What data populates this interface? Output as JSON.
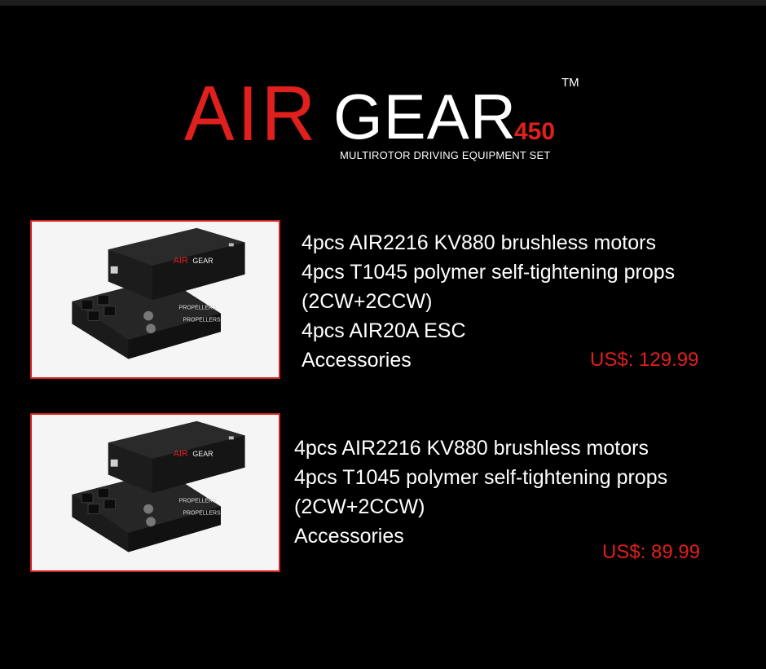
{
  "logo": {
    "air": "AIR",
    "gear": "GEAR",
    "model": "450",
    "tm": "TM",
    "subtitle": "MULTIROTOR DRIVING EQUIPMENT SET"
  },
  "products": [
    {
      "features": [
        "4pcs AIR2216 KV880 brushless motors",
        "4pcs T1045 polymer self-tightening props",
        "(2CW+2CCW)",
        "4pcs AIR20A ESC",
        "Accessories"
      ],
      "price": "US$:  129.99",
      "box_label_brand": "AIR",
      "box_label_model": "GEAR",
      "tray_labels": [
        "PROPELLERS",
        "PROPELLERS"
      ]
    },
    {
      "features": [
        "4pcs AIR2216 KV880 brushless motors",
        "4pcs T1045 polymer self-tightening props",
        "(2CW+2CCW)",
        "Accessories"
      ],
      "price": "US$:  89.99",
      "box_label_brand": "AIR",
      "box_label_model": "GEAR",
      "tray_labels": [
        "PROPELLERS",
        "PROPELLERS"
      ]
    }
  ],
  "colors": {
    "background": "#000000",
    "accent_red": "#e0201c",
    "text_white": "#ffffff",
    "thumb_border": "#d3201c"
  }
}
